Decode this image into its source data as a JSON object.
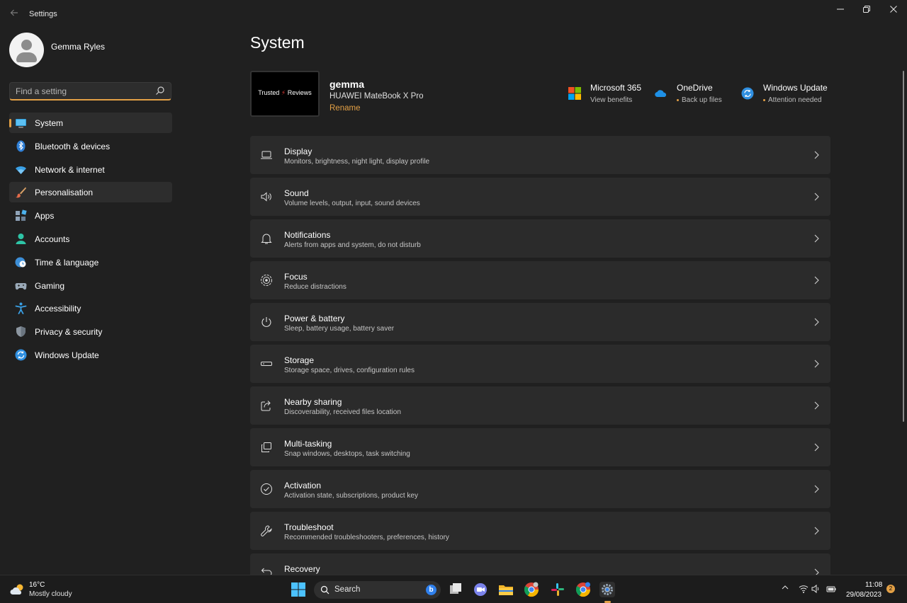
{
  "window": {
    "app_title": "Settings",
    "back_icon": "back-arrow-icon",
    "controls": [
      "minimize-icon",
      "restore-icon",
      "close-icon"
    ]
  },
  "profile": {
    "name": "Gemma Ryles"
  },
  "search": {
    "placeholder": "Find a setting"
  },
  "sidebar": {
    "accent_color": "#e3a045",
    "selected_index": 0,
    "items": [
      {
        "label": "System",
        "icon": "monitor-icon"
      },
      {
        "label": "Bluetooth & devices",
        "icon": "bluetooth-icon"
      },
      {
        "label": "Network & internet",
        "icon": "wifi-icon"
      },
      {
        "label": "Personalisation",
        "icon": "paintbrush-icon"
      },
      {
        "label": "Apps",
        "icon": "apps-icon"
      },
      {
        "label": "Accounts",
        "icon": "person-icon"
      },
      {
        "label": "Time & language",
        "icon": "globe-clock-icon"
      },
      {
        "label": "Gaming",
        "icon": "gamepad-icon"
      },
      {
        "label": "Accessibility",
        "icon": "accessibility-icon"
      },
      {
        "label": "Privacy & security",
        "icon": "shield-icon"
      },
      {
        "label": "Windows Update",
        "icon": "update-icon"
      }
    ]
  },
  "main": {
    "title": "System",
    "device": {
      "thumbnail_text_left": "Trusted",
      "thumbnail_text_right": "Reviews",
      "name": "gemma",
      "model": "HUAWEI MateBook X Pro",
      "rename_label": "Rename"
    },
    "quick_links": [
      {
        "title": "Microsoft 365",
        "subtitle": "View benefits",
        "icon": "microsoft-logo-icon",
        "dot": false
      },
      {
        "title": "OneDrive",
        "subtitle": "Back up files",
        "icon": "onedrive-cloud-icon",
        "dot": true
      },
      {
        "title": "Windows Update",
        "subtitle": "Attention needed",
        "icon": "update-icon",
        "dot": true
      }
    ],
    "settings": [
      {
        "title": "Display",
        "subtitle": "Monitors, brightness, night light, display profile",
        "icon": "laptop-icon"
      },
      {
        "title": "Sound",
        "subtitle": "Volume levels, output, input, sound devices",
        "icon": "speaker-icon"
      },
      {
        "title": "Notifications",
        "subtitle": "Alerts from apps and system, do not disturb",
        "icon": "bell-icon"
      },
      {
        "title": "Focus",
        "subtitle": "Reduce distractions",
        "icon": "focus-icon"
      },
      {
        "title": "Power & battery",
        "subtitle": "Sleep, battery usage, battery saver",
        "icon": "power-icon"
      },
      {
        "title": "Storage",
        "subtitle": "Storage space, drives, configuration rules",
        "icon": "storage-drive-icon"
      },
      {
        "title": "Nearby sharing",
        "subtitle": "Discoverability, received files location",
        "icon": "share-icon"
      },
      {
        "title": "Multi-tasking",
        "subtitle": "Snap windows, desktops, task switching",
        "icon": "multitask-icon"
      },
      {
        "title": "Activation",
        "subtitle": "Activation state, subscriptions, product key",
        "icon": "checkmark-circle-icon"
      },
      {
        "title": "Troubleshoot",
        "subtitle": "Recommended troubleshooters, preferences, history",
        "icon": "wrench-icon"
      },
      {
        "title": "Recovery",
        "subtitle": "",
        "icon": "recovery-icon"
      }
    ]
  },
  "taskbar": {
    "weather": {
      "temp": "16°C",
      "condition": "Mostly cloudy",
      "icon": "cloudy-sun-icon"
    },
    "search_label": "Search",
    "apps": [
      "file-explorer-icon",
      "teams-chat-icon",
      "folder-icon",
      "chrome-icon",
      "slack-icon",
      "chrome-profile-icon",
      "settings-gear-icon"
    ],
    "clock": {
      "time": "11:08",
      "date": "29/08/2023"
    },
    "notification_count": "2"
  }
}
